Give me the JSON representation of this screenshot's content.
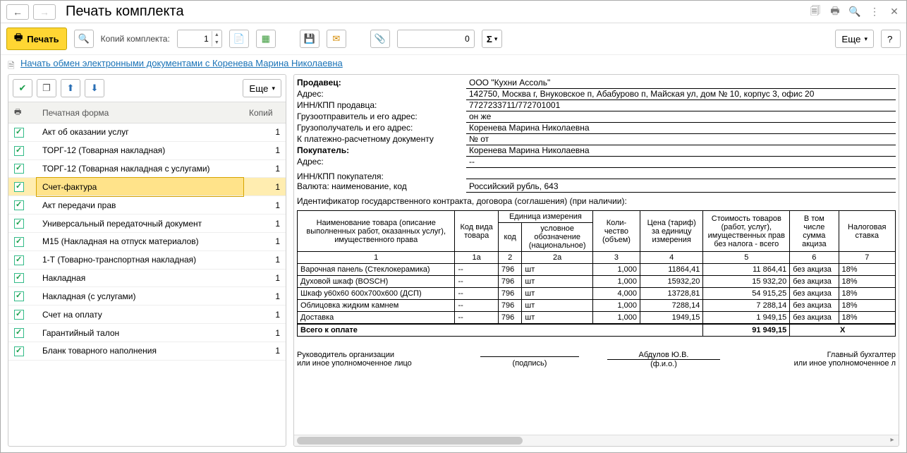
{
  "title": "Печать комплекта",
  "toolbar": {
    "print": "Печать",
    "copies_label": "Копий комплекта:",
    "copies_value": "1",
    "num_value": "0",
    "more": "Еще",
    "help": "?"
  },
  "link": "Начать обмен электронными документами с Коренева Марина Николаевна",
  "left": {
    "more": "Еще",
    "col_form": "Печатная форма",
    "col_copies": "Копий",
    "rows": [
      {
        "name": "Акт об оказании услуг",
        "copies": "1"
      },
      {
        "name": "ТОРГ-12 (Товарная накладная)",
        "copies": "1"
      },
      {
        "name": "ТОРГ-12 (Товарная накладная с услугами)",
        "copies": "1"
      },
      {
        "name": "Счет-фактура",
        "copies": "1",
        "selected": true
      },
      {
        "name": "Акт передачи прав",
        "copies": "1"
      },
      {
        "name": "Универсальный передаточный документ",
        "copies": "1"
      },
      {
        "name": "М15 (Накладная на отпуск материалов)",
        "copies": "1"
      },
      {
        "name": "1-Т (Товарно-транспортная накладная)",
        "copies": "1"
      },
      {
        "name": "Накладная",
        "copies": "1"
      },
      {
        "name": "Накладная (с услугами)",
        "copies": "1"
      },
      {
        "name": "Счет на оплату",
        "copies": "1"
      },
      {
        "name": "Гарантийный талон",
        "copies": "1"
      },
      {
        "name": "Бланк товарного наполнения",
        "copies": "1"
      }
    ]
  },
  "doc": {
    "keys": {
      "seller": "Продавец:",
      "address": "Адрес:",
      "inn": "ИНН/КПП продавца:",
      "shipper": "Грузоотправитель и его адрес:",
      "consignee": "Грузополучатель и его адрес:",
      "paydoc": "К платежно-расчетному документу",
      "buyer": "Покупатель:",
      "address2": "Адрес:",
      "inn2": "ИНН/КПП покупателя:",
      "currency": "Валюта: наименование, код",
      "contract": "Идентификатор государственного контракта, договора (соглашения) (при наличии):"
    },
    "vals": {
      "seller": "ООО \"Кухни Ассоль\"",
      "address": "142750, Москва г, Внуковское п, Абабурово п, Майская ул, дом № 10, корпус 3, офис 20",
      "inn": "7727233711/772701001",
      "shipper": "он же",
      "consignee": "Коренева Марина Николаевна",
      "paydoc": "№       от",
      "buyer": "Коренева Марина Николаевна",
      "address2": "--",
      "inn2": "",
      "currency": "Российский рубль, 643",
      "contract": ""
    },
    "tbl": {
      "h": {
        "name": "Наименование товара (описание выполненных работ, оказанных услуг), имущественного права",
        "kindcode": "Код вида товара",
        "unit": "Единица измерения",
        "unit_code": "код",
        "unit_sym": "условное обозначение (национальное)",
        "qty": "Коли-чество (объем)",
        "price": "Цена (тариф) за единицу измерения",
        "cost": "Стоимость товаров (работ, услуг), имущественных прав без налога - всего",
        "excise": "В том числе сумма акциза",
        "taxrate": "Налоговая ставка"
      },
      "cols": [
        "1",
        "1а",
        "2",
        "2а",
        "3",
        "4",
        "5",
        "6",
        "7"
      ],
      "rows": [
        {
          "name": "Варочная панель (Стеклокерамика)",
          "kc": "--",
          "code": "796",
          "sym": "шт",
          "qty": "1,000",
          "price": "11864,41",
          "cost": "11 864,41",
          "exc": "без акциза",
          "tax": "18%"
        },
        {
          "name": "Духовой шкаф (BOSCH)",
          "kc": "--",
          "code": "796",
          "sym": "шт",
          "qty": "1,000",
          "price": "15932,20",
          "cost": "15 932,20",
          "exc": "без акциза",
          "tax": "18%"
        },
        {
          "name": "Шкаф у60х60 600х700х600 (ДСП)",
          "kc": "--",
          "code": "796",
          "sym": "шт",
          "qty": "4,000",
          "price": "13728,81",
          "cost": "54 915,25",
          "exc": "без акциза",
          "tax": "18%"
        },
        {
          "name": "Облицовка жидким камнем",
          "kc": "--",
          "code": "796",
          "sym": "шт",
          "qty": "1,000",
          "price": "7288,14",
          "cost": "7 288,14",
          "exc": "без акциза",
          "tax": "18%"
        },
        {
          "name": "Доставка",
          "kc": "--",
          "code": "796",
          "sym": "шт",
          "qty": "1,000",
          "price": "1949,15",
          "cost": "1 949,15",
          "exc": "без акциза",
          "tax": "18%"
        }
      ],
      "total_label": "Всего к оплате",
      "total_cost": "91 949,15",
      "total_exc": "Х"
    },
    "sign": {
      "director1": "Руководитель организации",
      "director2": "или иное уполномоченное лицо",
      "sign_label": "(подпись)",
      "fio": "Абдулов Ю.В.",
      "fio_label": "(ф.и.о.)",
      "chief1": "Главный бухгалтер",
      "chief2": "или иное уполномоченное л"
    }
  }
}
